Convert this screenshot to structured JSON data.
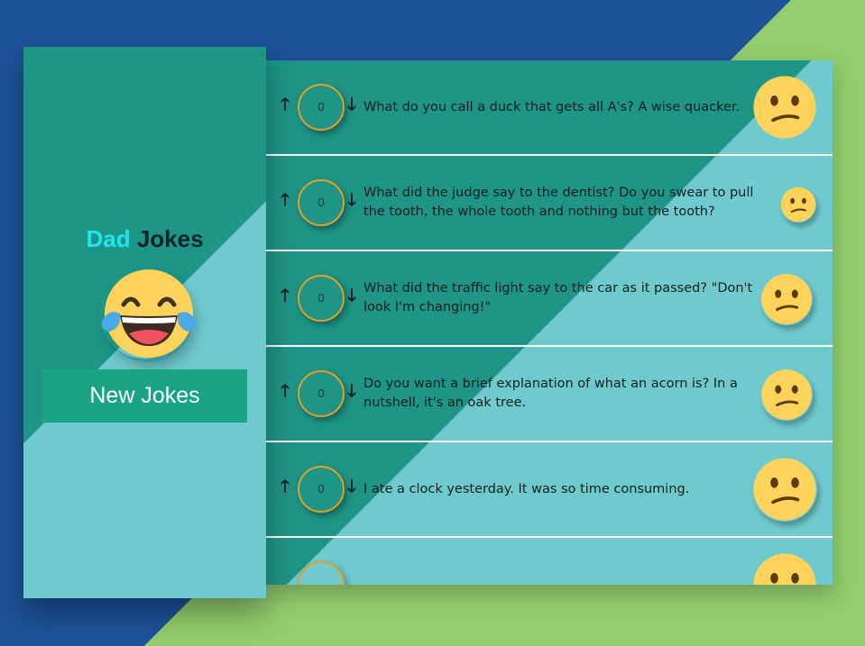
{
  "app": {
    "title_dad": "Dad",
    "title_jokes": "Jokes",
    "new_jokes_label": "New Jokes"
  },
  "icons": {
    "main": "laughing-tears-emoji",
    "joke_reaction": "confused-emoji",
    "upvote": "arrow-up",
    "downvote": "arrow-down"
  },
  "colors": {
    "background_blue": "#1d5297",
    "background_green": "#93cd6e",
    "teal_dark": "#1e9587",
    "teal_light": "#6fcacd",
    "button": "#19a585",
    "title_accent": "#21e5ec",
    "score_ring": "#e2a126"
  },
  "jokes": [
    {
      "votes": "0",
      "text": "What do you call a duck that gets all A's? A wise quacker.",
      "up": "🡑",
      "down": "🡓"
    },
    {
      "votes": "0",
      "text": "What did the judge say to the dentist? Do you swear to pull the tooth, the whole tooth and nothing but the tooth?",
      "up": "🡑",
      "down": "🡓"
    },
    {
      "votes": "0",
      "text": "What did the traffic light say to the car as it passed? \"Don't look I'm changing!\"",
      "up": "🡑",
      "down": "🡓"
    },
    {
      "votes": "0",
      "text": "Do you want a brief explanation of what an acorn is? In a nutshell, it's an oak tree.",
      "up": "🡑",
      "down": "🡓"
    },
    {
      "votes": "0",
      "text": "I ate a clock yesterday. It was so time consuming.",
      "up": "🡑",
      "down": "🡓"
    },
    {
      "votes": "",
      "text": "",
      "up": "",
      "down": ""
    }
  ]
}
